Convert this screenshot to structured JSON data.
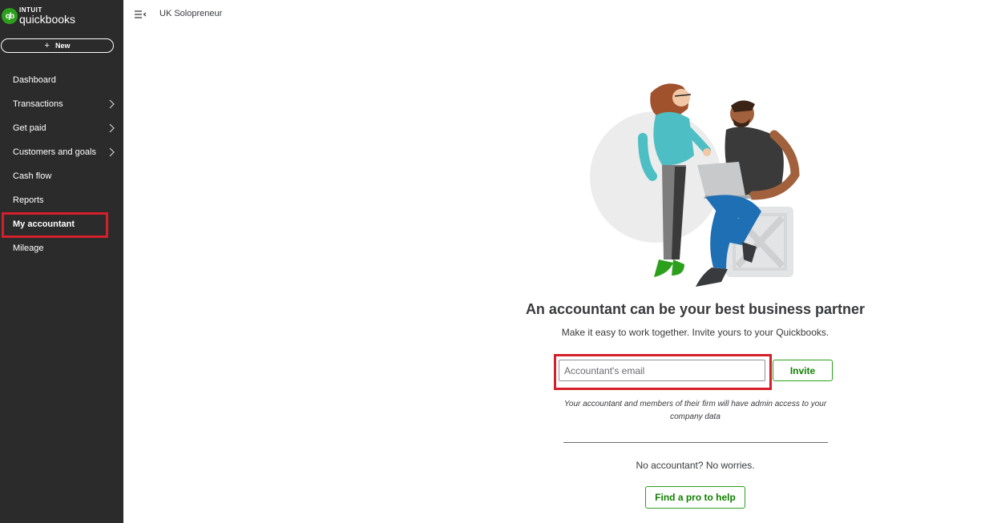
{
  "sidebar": {
    "logo": {
      "intuit": "INTUIT",
      "product": "quickbooks"
    },
    "new_button": {
      "label": "New",
      "icon": "plus-icon"
    },
    "items": [
      {
        "label": "Dashboard",
        "has_chevron": false
      },
      {
        "label": "Transactions",
        "has_chevron": true
      },
      {
        "label": "Get paid",
        "has_chevron": true
      },
      {
        "label": "Customers and goals",
        "has_chevron": true
      },
      {
        "label": "Cash flow",
        "has_chevron": false
      },
      {
        "label": "Reports",
        "has_chevron": false
      },
      {
        "label": "My accountant",
        "has_chevron": false,
        "active": true
      },
      {
        "label": "Mileage",
        "has_chevron": false
      }
    ]
  },
  "header": {
    "menu_icon": "collapse-menu-icon",
    "company_name": "UK Solopreneur"
  },
  "main": {
    "illustration": "accountant-partnership-illustration",
    "headline": "An accountant can be your best business partner",
    "subline": "Make it easy to work together. Invite yours to your Quickbooks.",
    "email_input": {
      "placeholder": "Accountant's email",
      "value": ""
    },
    "invite_label": "Invite",
    "disclaimer": "Your accountant and members of their firm will have admin access to your company data",
    "no_accountant_text": "No accountant? No worries.",
    "find_pro_label": "Find a pro to help"
  },
  "colors": {
    "sidebar_bg": "#2b2b2b",
    "brand_green": "#2ca01c",
    "button_text_green": "#108000",
    "highlight_red": "#d4202a",
    "text": "#393a3d"
  }
}
